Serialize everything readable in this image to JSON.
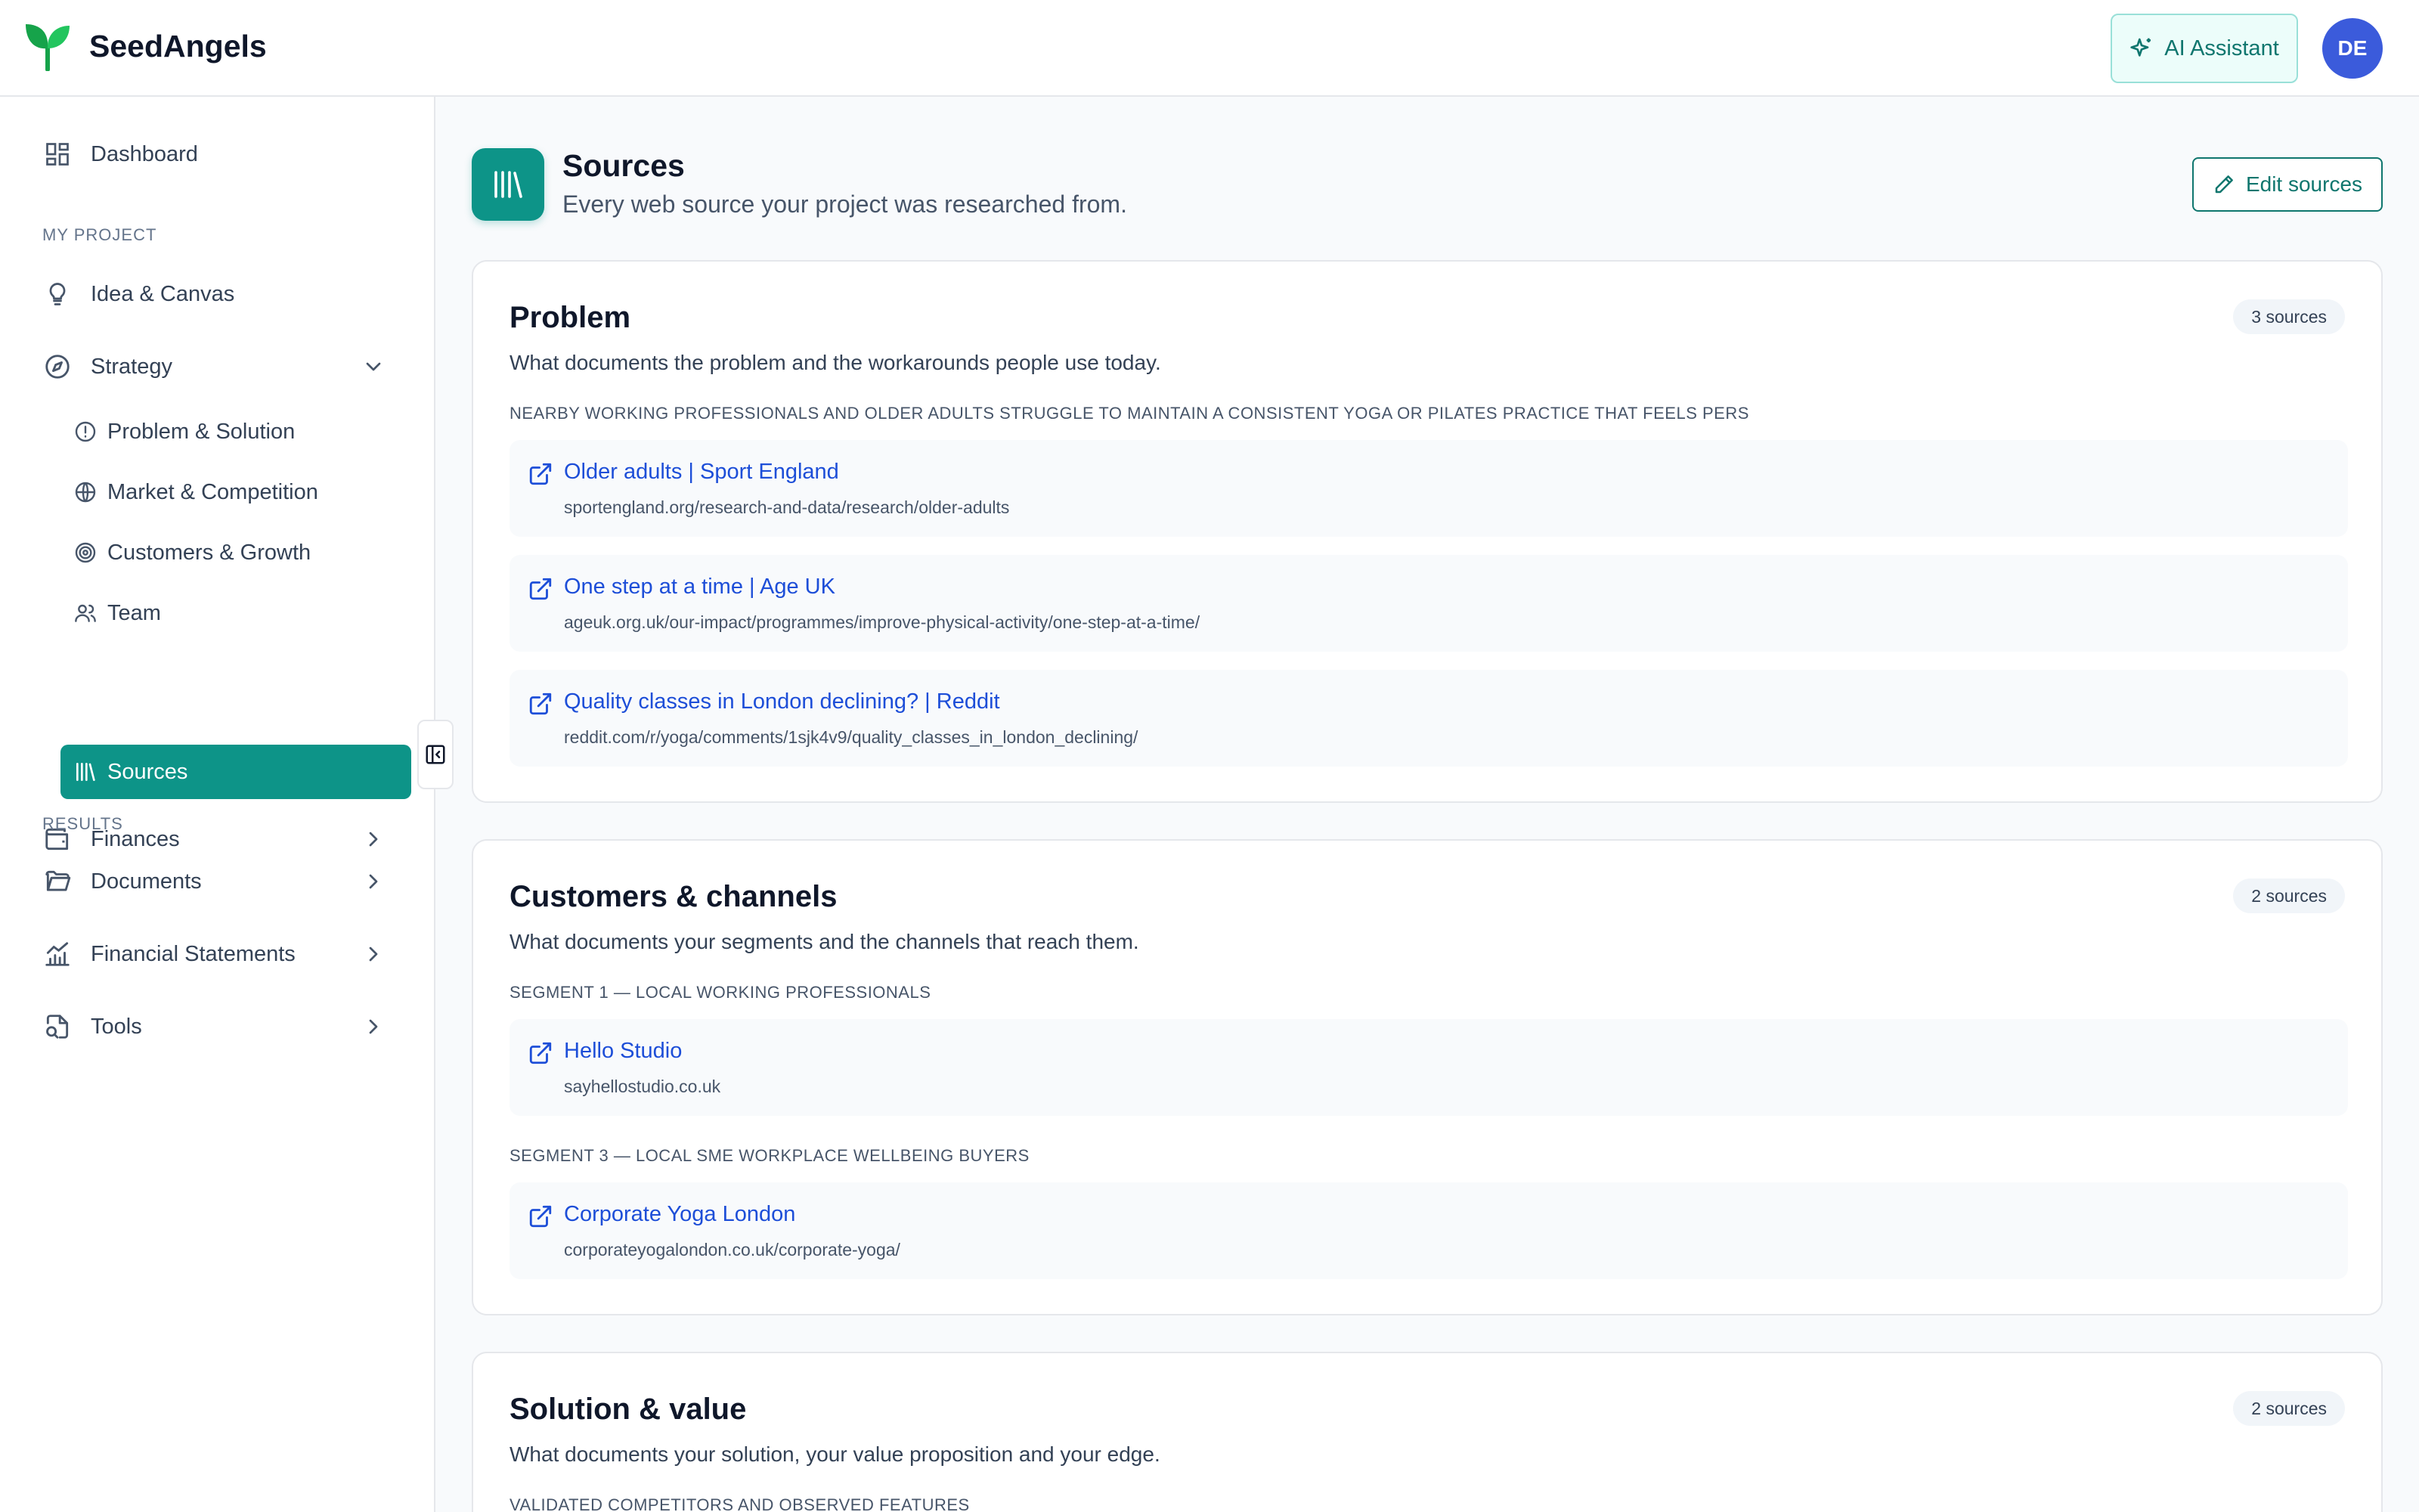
{
  "app": {
    "name": "SeedAngels"
  },
  "topbar": {
    "ai_label": "AI Assistant",
    "avatar_initials": "DE"
  },
  "sidebar": {
    "dashboard": "Dashboard",
    "section_project": "MY PROJECT",
    "idea": "Idea & Canvas",
    "strategy": "Strategy",
    "strategy_items": [
      "Problem & Solution",
      "Market & Competition",
      "Customers & Growth",
      "Team",
      "Sources"
    ],
    "finances": "Finances",
    "section_results": "RESULTS",
    "documents": "Documents",
    "statements": "Financial Statements",
    "tools": "Tools"
  },
  "header": {
    "title": "Sources",
    "subtitle": "Every web source your project was researched from.",
    "edit_label": "Edit sources"
  },
  "sections": [
    {
      "title": "Problem",
      "subtitle": "What documents the problem and the workarounds people use today.",
      "count": "3 sources",
      "groups": [
        {
          "label": "NEARBY WORKING PROFESSIONALS AND OLDER ADULTS STRUGGLE TO MAINTAIN A CONSISTENT YOGA OR PILATES PRACTICE THAT FEELS PERS",
          "items": [
            {
              "title": "Older adults | Sport England",
              "url": "sportengland.org/research-and-data/research/older-adults"
            },
            {
              "title": "One step at a time | Age UK",
              "url": "ageuk.org.uk/our-impact/programmes/improve-physical-activity/one-step-at-a-time/"
            },
            {
              "title": "Quality classes in London declining? | Reddit",
              "url": "reddit.com/r/yoga/comments/1sjk4v9/quality_classes_in_london_declining/"
            }
          ]
        }
      ]
    },
    {
      "title": "Customers & channels",
      "subtitle": "What documents your segments and the channels that reach them.",
      "count": "2 sources",
      "groups": [
        {
          "label": "SEGMENT 1 — LOCAL WORKING PROFESSIONALS",
          "items": [
            {
              "title": "Hello Studio",
              "url": "sayhellostudio.co.uk"
            }
          ]
        },
        {
          "label": "SEGMENT 3 — LOCAL SME WORKPLACE WELLBEING BUYERS",
          "items": [
            {
              "title": "Corporate Yoga London",
              "url": "corporateyogalondon.co.uk/corporate-yoga/"
            }
          ]
        }
      ]
    },
    {
      "title": "Solution & value",
      "subtitle": "What documents your solution, your value proposition and your edge.",
      "count": "2 sources",
      "groups": [
        {
          "label": "VALIDATED COMPETITORS AND OBSERVED FEATURES"
        }
      ]
    }
  ],
  "colors": {
    "accent": "#0d9488",
    "link": "#1d4ed8",
    "avatar": "#3b5bdb"
  },
  "icons": [
    "sprout-logo",
    "sparkles-icon",
    "dashboard-icon",
    "lightbulb-icon",
    "compass-icon",
    "alert-circle-icon",
    "globe-icon",
    "target-icon",
    "users-icon",
    "library-icon",
    "wallet-icon",
    "folder-icon",
    "chart-icon",
    "file-search-icon",
    "chevron-down-icon",
    "chevron-right-icon",
    "panel-collapse-icon",
    "pencil-icon",
    "external-link-icon"
  ]
}
